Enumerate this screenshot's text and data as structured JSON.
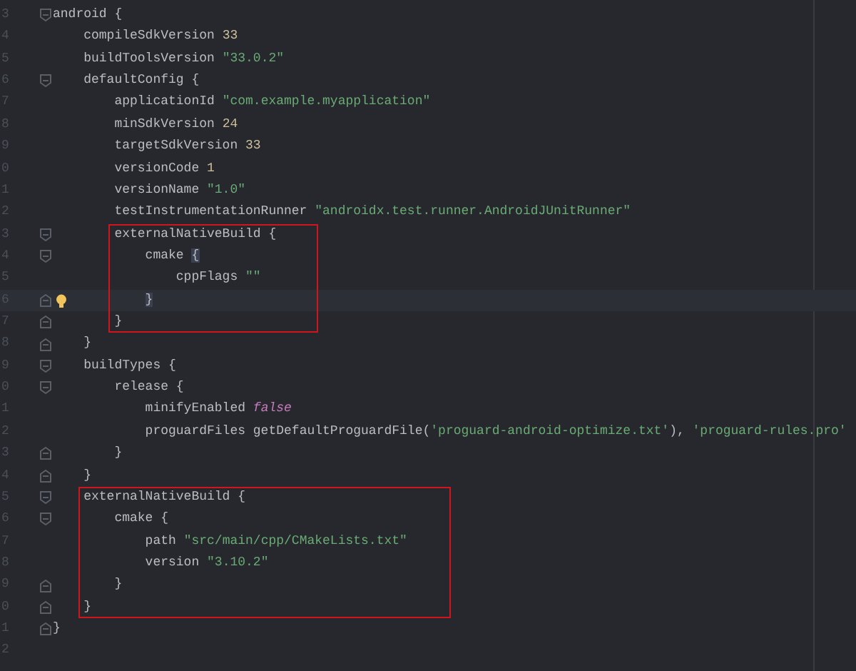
{
  "editor": {
    "lines": [
      {
        "kind": "fold-start",
        "number": "3",
        "current": false,
        "bulb": false,
        "tokens": [
          {
            "text": "android {",
            "kind": "plain"
          }
        ],
        "children": [
          {
            "kind": "line",
            "number": "4",
            "current": false,
            "bulb": false,
            "tokens": [
              {
                "text": "compileSdkVersion ",
                "kind": "plain"
              },
              {
                "text": "33",
                "kind": "number"
              }
            ]
          },
          {
            "kind": "line",
            "number": "5",
            "current": false,
            "bulb": false,
            "tokens": [
              {
                "text": "buildToolsVersion ",
                "kind": "plain"
              },
              {
                "text": "\"33.0.2\"",
                "kind": "string"
              }
            ]
          },
          {
            "kind": "fold-start",
            "number": "6",
            "current": false,
            "bulb": false,
            "tokens": [
              {
                "text": "defaultConfig {",
                "kind": "plain"
              }
            ],
            "children": [
              {
                "kind": "line",
                "number": "7",
                "current": false,
                "bulb": false,
                "tokens": [
                  {
                    "text": "applicationId ",
                    "kind": "plain"
                  },
                  {
                    "text": "\"com.example.myapplication\"",
                    "kind": "string"
                  }
                ]
              },
              {
                "kind": "line",
                "number": "8",
                "current": false,
                "bulb": false,
                "tokens": [
                  {
                    "text": "minSdkVersion ",
                    "kind": "plain"
                  },
                  {
                    "text": "24",
                    "kind": "number"
                  }
                ]
              },
              {
                "kind": "line",
                "number": "9",
                "current": false,
                "bulb": false,
                "tokens": [
                  {
                    "text": "targetSdkVersion ",
                    "kind": "plain"
                  },
                  {
                    "text": "33",
                    "kind": "number"
                  }
                ]
              },
              {
                "kind": "line",
                "number": "0",
                "current": false,
                "bulb": false,
                "tokens": [
                  {
                    "text": "versionCode ",
                    "kind": "plain"
                  },
                  {
                    "text": "1",
                    "kind": "number"
                  }
                ]
              },
              {
                "kind": "line",
                "number": "1",
                "current": false,
                "bulb": false,
                "tokens": [
                  {
                    "text": "versionName ",
                    "kind": "plain"
                  },
                  {
                    "text": "\"1.0\"",
                    "kind": "string"
                  }
                ]
              },
              {
                "kind": "line",
                "number": "2",
                "current": false,
                "bulb": false,
                "tokens": [
                  {
                    "text": "testInstrumentationRunner ",
                    "kind": "plain"
                  },
                  {
                    "text": "\"androidx.test.runner.AndroidJUnitRunner\"",
                    "kind": "string"
                  }
                ]
              },
              {
                "kind": "boxed",
                "lines": [
                  {
                    "kind": "fold-start",
                    "number": "3",
                    "current": false,
                    "bulb": false,
                    "tokens": [
                      {
                        "text": "externalNativeBuild {",
                        "kind": "plain"
                      }
                    ],
                    "children": [
                      {
                        "kind": "fold-start",
                        "number": "4",
                        "current": false,
                        "bulb": false,
                        "tokens": [
                          {
                            "text": "cmake ",
                            "kind": "plain"
                          },
                          {
                            "text": "{",
                            "kind": "brace-match"
                          }
                        ],
                        "children": [
                          {
                            "kind": "line",
                            "number": "5",
                            "current": false,
                            "bulb": false,
                            "tokens": [
                              {
                                "text": "cppFlags ",
                                "kind": "plain"
                              },
                              {
                                "text": "\"\"",
                                "kind": "string"
                              }
                            ]
                          }
                        ]
                      },
                      {
                        "kind": "fold-end",
                        "number": "6",
                        "current": true,
                        "bulb": true,
                        "tokens": [
                          {
                            "text": "}",
                            "kind": "brace-match"
                          }
                        ]
                      }
                    ]
                  },
                  {
                    "kind": "fold-end",
                    "number": "7",
                    "current": false,
                    "bulb": false,
                    "tokens": [
                      {
                        "text": "}",
                        "kind": "plain"
                      }
                    ]
                  }
                ]
              }
            ]
          },
          {
            "kind": "fold-end",
            "number": "8",
            "current": false,
            "bulb": false,
            "tokens": [
              {
                "text": "}",
                "kind": "plain"
              }
            ]
          },
          {
            "kind": "fold-start",
            "number": "9",
            "current": false,
            "bulb": false,
            "tokens": [
              {
                "text": "buildTypes {",
                "kind": "plain"
              }
            ],
            "children": [
              {
                "kind": "fold-start",
                "number": "0",
                "current": false,
                "bulb": false,
                "tokens": [
                  {
                    "text": "release {",
                    "kind": "plain"
                  }
                ],
                "children": [
                  {
                    "kind": "line",
                    "number": "1",
                    "current": false,
                    "bulb": false,
                    "tokens": [
                      {
                        "text": "minifyEnabled ",
                        "kind": "plain"
                      },
                      {
                        "text": "false",
                        "kind": "keyword"
                      }
                    ]
                  },
                  {
                    "kind": "line",
                    "number": "2",
                    "current": false,
                    "bulb": false,
                    "tokens": [
                      {
                        "text": "proguardFiles getDefaultProguardFile(",
                        "kind": "plain"
                      },
                      {
                        "text": "'proguard-android-optimize.txt'",
                        "kind": "string"
                      },
                      {
                        "text": "), ",
                        "kind": "plain"
                      },
                      {
                        "text": "'proguard-rules.pro'",
                        "kind": "string"
                      }
                    ]
                  }
                ]
              },
              {
                "kind": "fold-end",
                "number": "3",
                "current": false,
                "bulb": false,
                "tokens": [
                  {
                    "text": "}",
                    "kind": "plain"
                  }
                ]
              }
            ]
          },
          {
            "kind": "fold-end",
            "number": "4",
            "current": false,
            "bulb": false,
            "tokens": [
              {
                "text": "}",
                "kind": "plain"
              }
            ]
          },
          {
            "kind": "boxed",
            "lines": [
              {
                "kind": "fold-start",
                "number": "5",
                "current": false,
                "bulb": false,
                "tokens": [
                  {
                    "text": "externalNativeBuild {",
                    "kind": "plain"
                  }
                ],
                "children": [
                  {
                    "kind": "fold-start",
                    "number": "6",
                    "current": false,
                    "bulb": false,
                    "tokens": [
                      {
                        "text": "cmake {",
                        "kind": "plain"
                      }
                    ],
                    "children": [
                      {
                        "kind": "line",
                        "number": "7",
                        "current": false,
                        "bulb": false,
                        "tokens": [
                          {
                            "text": "path ",
                            "kind": "plain"
                          },
                          {
                            "text": "\"src/main/cpp/CMakeLists.txt\"",
                            "kind": "string"
                          }
                        ]
                      },
                      {
                        "kind": "line",
                        "number": "8",
                        "current": false,
                        "bulb": false,
                        "tokens": [
                          {
                            "text": "version ",
                            "kind": "plain"
                          },
                          {
                            "text": "\"3.10.2\"",
                            "kind": "string"
                          }
                        ]
                      }
                    ]
                  },
                  {
                    "kind": "fold-end",
                    "number": "9",
                    "current": false,
                    "bulb": false,
                    "tokens": [
                      {
                        "text": "}",
                        "kind": "plain"
                      }
                    ]
                  }
                ]
              },
              {
                "kind": "fold-end",
                "number": "0",
                "current": false,
                "bulb": false,
                "tokens": [
                  {
                    "text": "}",
                    "kind": "plain"
                  }
                ]
              }
            ]
          }
        ]
      },
      {
        "kind": "fold-end",
        "number": "1",
        "current": false,
        "bulb": false,
        "tokens": [
          {
            "text": "}",
            "kind": "plain"
          }
        ]
      },
      {
        "kind": "line",
        "number": "2",
        "current": false,
        "bulb": false
      }
    ]
  }
}
